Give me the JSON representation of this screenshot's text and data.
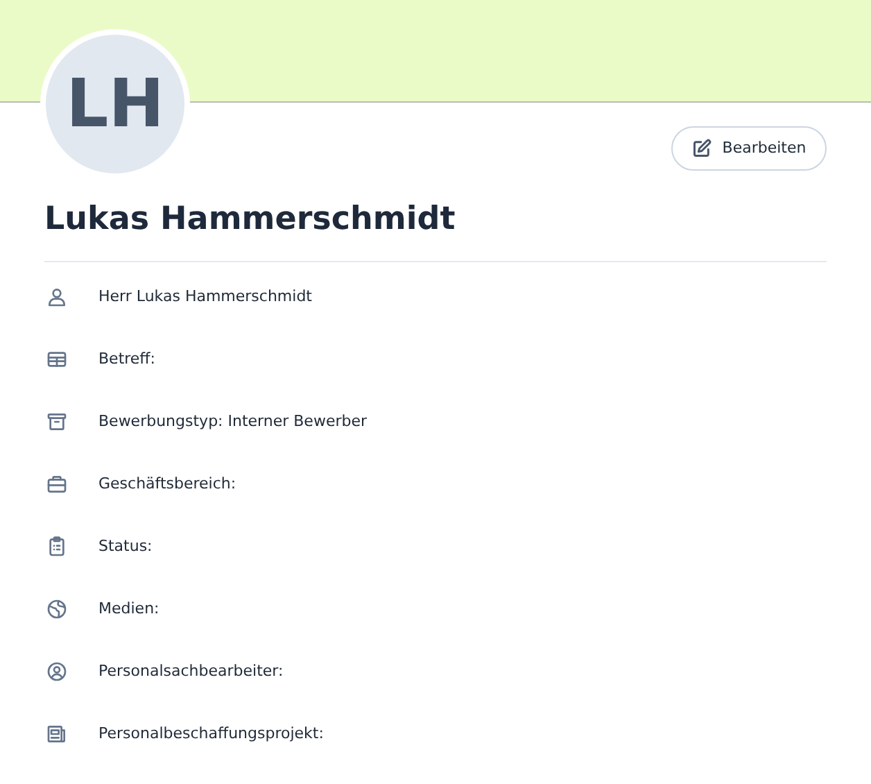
{
  "avatar": {
    "initials": "LH"
  },
  "edit_button": {
    "label": "Bearbeiten"
  },
  "name": "Lukas Hammerschmidt",
  "details": [
    {
      "text": "Herr Lukas Hammerschmidt"
    },
    {
      "text": "Betreff:"
    },
    {
      "text": "Bewerbungstyp: Interner Bewerber"
    },
    {
      "text": "Geschäftsbereich:"
    },
    {
      "text": "Status:"
    },
    {
      "text": "Medien:"
    },
    {
      "text": "Personalsachbearbeiter:"
    },
    {
      "text": "Personalbeschaffungsprojekt:"
    }
  ]
}
